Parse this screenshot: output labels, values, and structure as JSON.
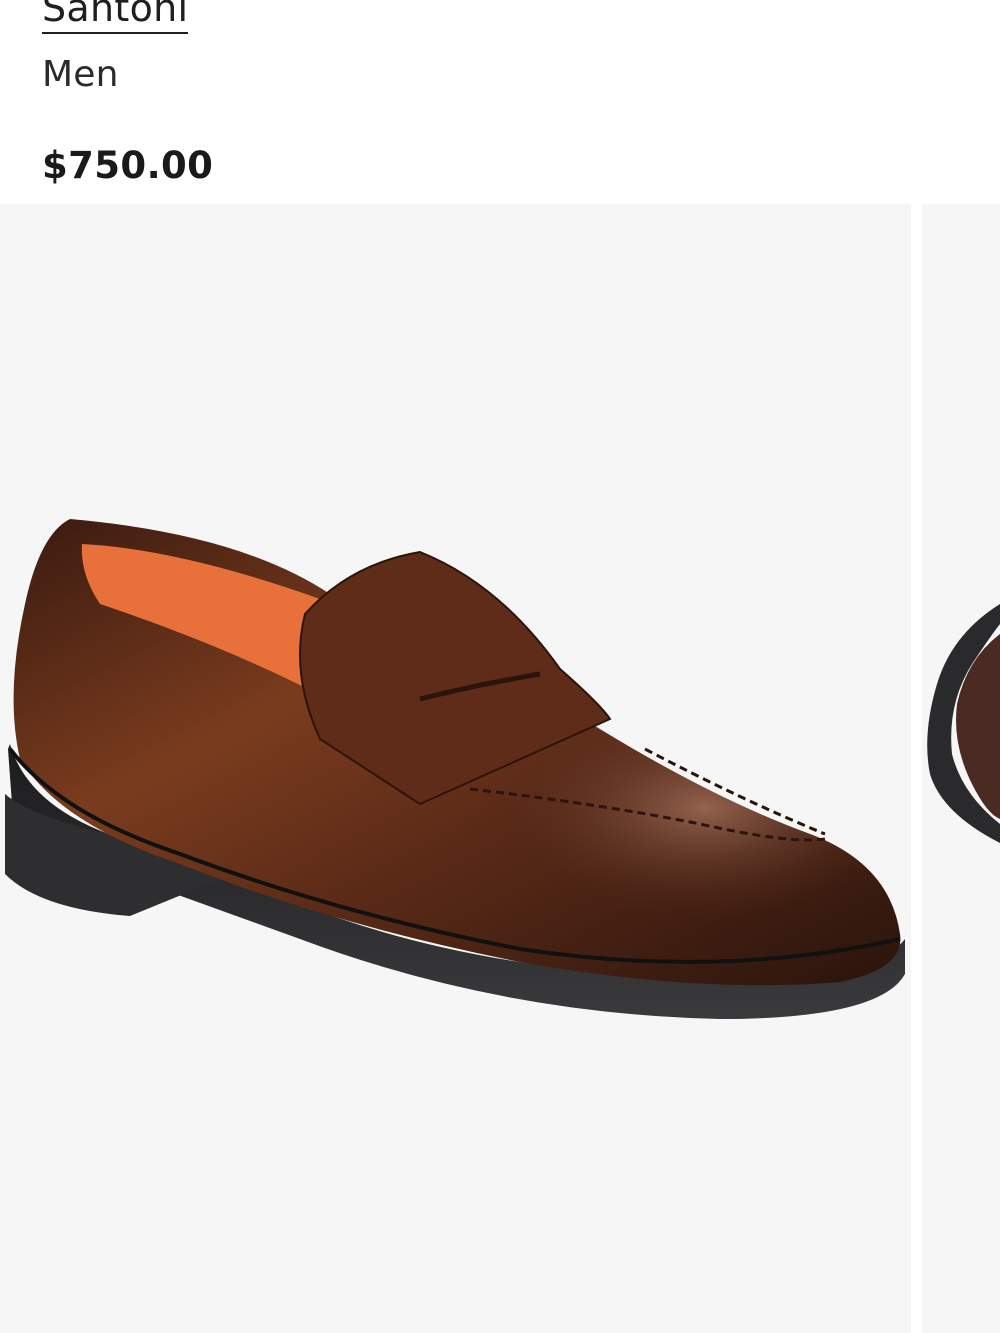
{
  "product": {
    "brand": "Santoni",
    "category": "Men",
    "price": "$750.00"
  },
  "gallery": {
    "images": [
      {
        "name": "brown-leather-penny-loafer-side-view"
      },
      {
        "name": "brown-leather-penny-loafer-alternate-view"
      }
    ]
  },
  "colors": {
    "background": "#ffffff",
    "image_background": "#f6f6f6",
    "leather": "#5a2a17",
    "lining": "#e8703a",
    "sole": "#2a2a2c"
  }
}
